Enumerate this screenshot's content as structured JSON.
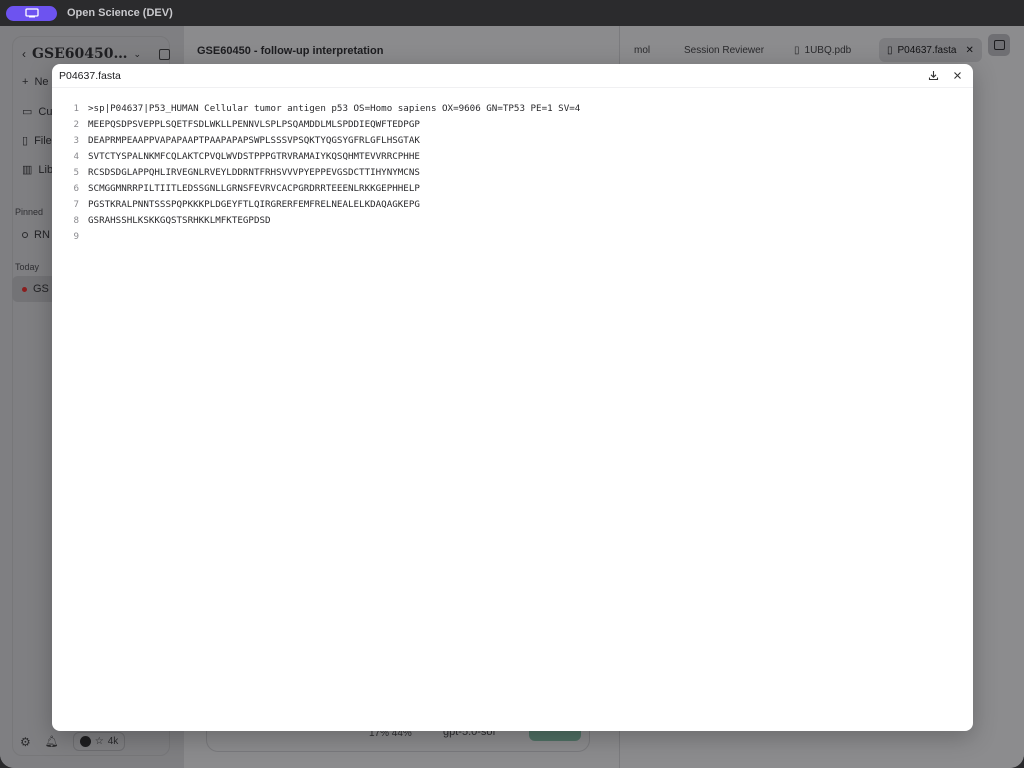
{
  "app": {
    "title": "Open Science (DEV)"
  },
  "sidebar": {
    "workspace": "GSE60450…",
    "items": [
      {
        "label": "Ne",
        "icon": "plus-icon"
      },
      {
        "label": "Cu",
        "icon": "briefcase-icon"
      },
      {
        "label": "File",
        "icon": "file-icon"
      },
      {
        "label": "Lib",
        "icon": "book-icon"
      }
    ],
    "pinned_label": "Pinned",
    "pinned_item": "RN",
    "today_label": "Today",
    "today_item": "GS",
    "github_stars": "4k"
  },
  "main": {
    "title": "GSE60450 - follow-up interpretation",
    "zoom": "17% 44%",
    "model": "gpt-5.0-sof"
  },
  "right_panel": {
    "tabs": [
      {
        "label": "mol"
      },
      {
        "label": "Session Reviewer"
      },
      {
        "label": "1UBQ.pdb"
      },
      {
        "label": "P04637.fasta"
      }
    ]
  },
  "modal": {
    "title": "P04637.fasta",
    "lines": [
      {
        "no": "1",
        "text": ">sp|P04637|P53_HUMAN Cellular tumor antigen p53 OS=Homo sapiens OX=9606 GN=TP53 PE=1 SV=4"
      },
      {
        "no": "2",
        "text": "MEEPQSDPSVEPPLSQETFSDLWKLLPENNVLSPLPSQAMDDLMLSPDDIEQWFTEDPGP"
      },
      {
        "no": "3",
        "text": "DEAPRMPEAAPPVAPAPAAPTPAAPAPAPSWPLSSSVPSQKTYQGSYGFRLGFLHSGTAK"
      },
      {
        "no": "4",
        "text": "SVTCTYSPALNKMFCQLAKTCPVQLWVDSTPPPGTRVRAMAIYKQSQHMTEVVRRCPHHE"
      },
      {
        "no": "5",
        "text": "RCSDSDGLAPPQHLIRVEGNLRVEYLDDRNTFRHSVVVPYEPPEVGSDCTTIHYNYMCNS"
      },
      {
        "no": "6",
        "text": "SCMGGMNRRPILTIITLEDSSGNLLGRNSFEVRVCACPGRDRRTEEENLRKKGEPHHELP"
      },
      {
        "no": "7",
        "text": "PGSTKRALPNNTSSSPQPKKKPLDGEYFTLQIRGRERFEMFRELNEALELKDAQAGKEPG"
      },
      {
        "no": "8",
        "text": "GSRAHSSHLKSKKGQSTSRHKKLMFKTEGPDSD"
      },
      {
        "no": "9",
        "text": ""
      }
    ]
  },
  "colors": {
    "accent": "#6d53f0",
    "titlebar": "#2b2b2d",
    "send": "#4f7064"
  }
}
